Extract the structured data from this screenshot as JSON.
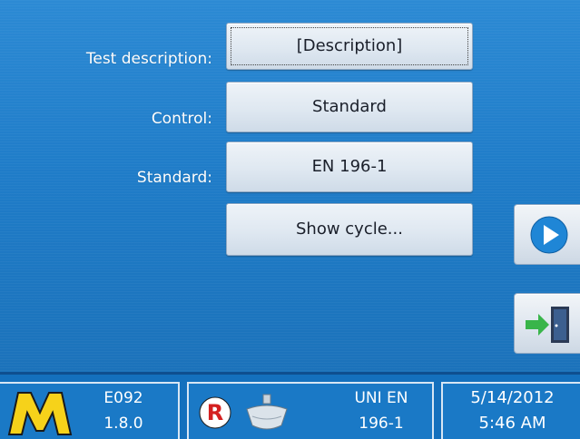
{
  "form": {
    "test_description": {
      "label": "Test description:",
      "value": "[Description]"
    },
    "control": {
      "label": "Control:",
      "value": "Standard"
    },
    "standard": {
      "label": "Standard:",
      "value": "EN 196-1"
    },
    "show_cycle_label": "Show cycle..."
  },
  "side_buttons": {
    "play_icon": "play-icon",
    "exit_icon": "exit-door-icon"
  },
  "status": {
    "logo_icon": "m-logo-icon",
    "model": "E092",
    "version": "1.8.0",
    "mode_badge": "R",
    "standard_line1": "UNI EN",
    "standard_line2": "196-1",
    "date": "5/14/2012",
    "time": "5:46 AM"
  },
  "colors": {
    "background": "#1f7cc8",
    "button": "#dfe8f1",
    "play": "#1f86d6",
    "logo_yellow": "#f6d21a",
    "badge_red": "#d42020"
  }
}
